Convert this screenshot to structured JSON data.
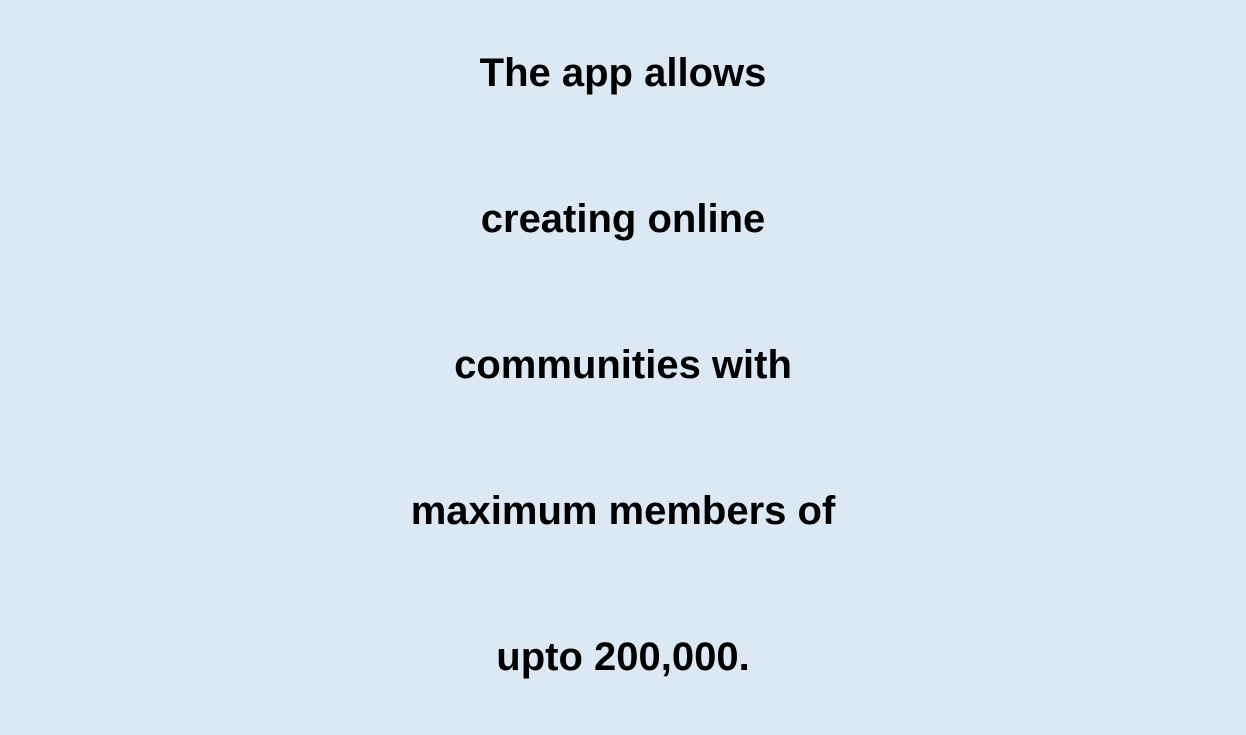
{
  "statement": {
    "lines": [
      "The app allows",
      "creating online",
      "communities with",
      "maximum members of",
      "upto 200,000."
    ]
  },
  "colors": {
    "background": "#dde8f5",
    "text": "#000000"
  }
}
